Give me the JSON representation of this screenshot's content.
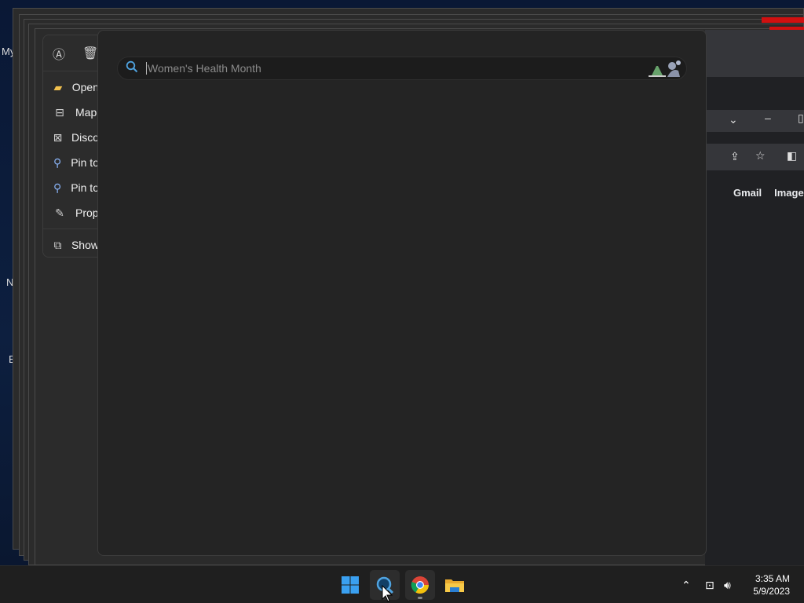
{
  "desktop": {
    "labels": [
      "My",
      "N",
      "E"
    ]
  },
  "context_menu": {
    "items": [
      {
        "label": "Open",
        "icon": "folder-icon"
      },
      {
        "label": "Map",
        "icon": "map-drive-icon"
      },
      {
        "label": "Disco",
        "icon": "disconnect-icon"
      },
      {
        "label": "Pin to",
        "icon": "pin-icon"
      },
      {
        "label": "Pin to",
        "icon": "pin-icon"
      },
      {
        "label": "Prop",
        "icon": "wrench-icon"
      },
      {
        "label": "Show",
        "icon": "more-options-icon"
      }
    ]
  },
  "search_panel": {
    "placeholder": "Women's Health Month",
    "value": ""
  },
  "browser": {
    "links": [
      "Gmail",
      "Images"
    ]
  },
  "taskbar": {
    "apps": [
      {
        "name": "start-button",
        "icon": "windows-logo-icon"
      },
      {
        "name": "search-button",
        "icon": "search-icon"
      },
      {
        "name": "chrome-button",
        "icon": "chrome-icon"
      },
      {
        "name": "file-explorer-button",
        "icon": "folder-icon"
      }
    ],
    "clock": {
      "time": "3:35 AM",
      "date": "5/9/2023"
    }
  },
  "colors": {
    "accent": "#4fa3e0",
    "panel_bg": "#242424",
    "taskbar_bg": "#1f1f1f"
  }
}
